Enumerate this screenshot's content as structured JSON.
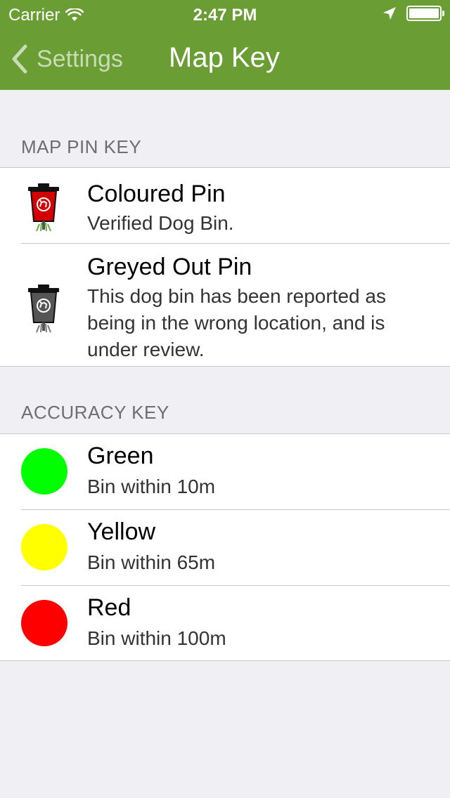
{
  "status_bar": {
    "carrier": "Carrier",
    "time": "2:47 PM"
  },
  "nav": {
    "back_label": "Settings",
    "title": "Map Key"
  },
  "map_pin_key": {
    "header": "MAP PIN KEY",
    "items": [
      {
        "icon": "red-dog-bin-pin-icon",
        "title": "Coloured Pin",
        "subtitle": "Verified Dog Bin."
      },
      {
        "icon": "grey-dog-bin-pin-icon",
        "title": "Greyed Out Pin",
        "subtitle": "This dog bin has been reported as being in the wrong location, and is under review."
      }
    ]
  },
  "accuracy_key": {
    "header": "ACCURACY KEY",
    "items": [
      {
        "color": "#00ff00",
        "title": "Green",
        "subtitle": "Bin within 10m"
      },
      {
        "color": "#ffff00",
        "title": "Yellow",
        "subtitle": "Bin within 65m"
      },
      {
        "color": "#ff0000",
        "title": "Red",
        "subtitle": "Bin within 100m"
      }
    ]
  },
  "colors": {
    "nav_bar": "#6a9d34",
    "pin_red": "#d40000",
    "pin_grey": "#555555"
  }
}
